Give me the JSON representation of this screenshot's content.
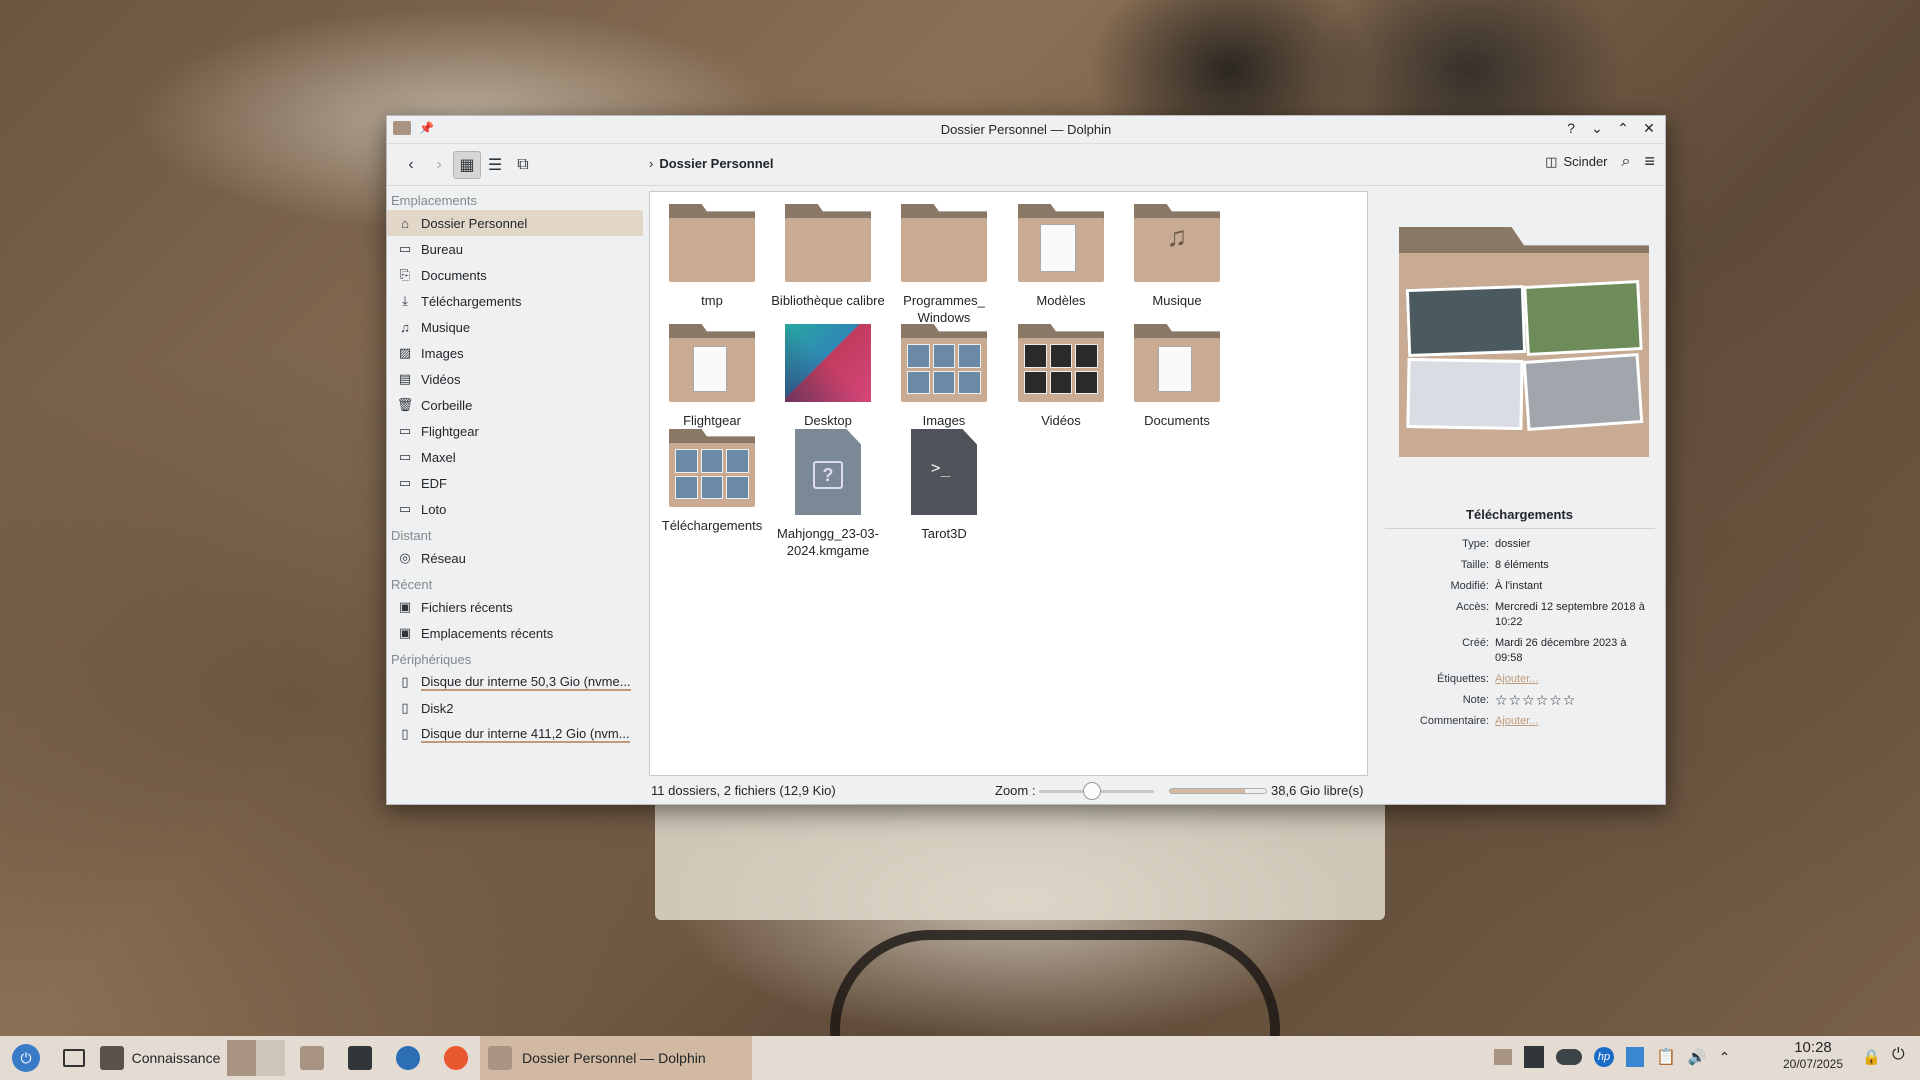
{
  "window": {
    "title": "Dossier Personnel — Dolphin",
    "breadcrumb": "Dossier Personnel",
    "split_label": "Scinder"
  },
  "sidebar": {
    "sections": [
      {
        "title": "Emplacements",
        "items": [
          {
            "label": "Dossier Personnel",
            "icon": "home-icon",
            "glyph": "⌂",
            "selected": true
          },
          {
            "label": "Bureau",
            "icon": "desktop-icon",
            "glyph": "▭"
          },
          {
            "label": "Documents",
            "icon": "documents-icon",
            "glyph": "⎘"
          },
          {
            "label": "Téléchargements",
            "icon": "download-icon",
            "glyph": "⤓"
          },
          {
            "label": "Musique",
            "icon": "music-icon",
            "glyph": "♫"
          },
          {
            "label": "Images",
            "icon": "images-icon",
            "glyph": "▨"
          },
          {
            "label": "Vidéos",
            "icon": "video-icon",
            "glyph": "▤"
          },
          {
            "label": "Corbeille",
            "icon": "trash-icon",
            "glyph": "🗑"
          },
          {
            "label": "Flightgear",
            "icon": "folder-icon",
            "glyph": "▭"
          },
          {
            "label": "Maxel",
            "icon": "folder-icon",
            "glyph": "▭"
          },
          {
            "label": "EDF",
            "icon": "folder-icon",
            "glyph": "▭"
          },
          {
            "label": "Loto",
            "icon": "folder-icon",
            "glyph": "▭"
          }
        ]
      },
      {
        "title": "Distant",
        "items": [
          {
            "label": "Réseau",
            "icon": "network-icon",
            "glyph": "◎"
          }
        ]
      },
      {
        "title": "Récent",
        "items": [
          {
            "label": "Fichiers récents",
            "icon": "recent-files-icon",
            "glyph": "▣"
          },
          {
            "label": "Emplacements récents",
            "icon": "recent-locations-icon",
            "glyph": "▣"
          }
        ]
      },
      {
        "title": "Périphériques",
        "items": [
          {
            "label": "Disque dur interne 50,3 Gio (nvme...",
            "icon": "drive-icon",
            "glyph": "▯",
            "disk": true
          },
          {
            "label": "Disk2",
            "icon": "drive-icon",
            "glyph": "▯"
          },
          {
            "label": "Disque dur interne 411,2 Gio (nvm...",
            "icon": "drive-icon",
            "glyph": "▯",
            "disk": true
          }
        ]
      }
    ]
  },
  "files": [
    {
      "name": "tmp",
      "kind": "folder"
    },
    {
      "name": "Bibliothèque calibre",
      "kind": "folder"
    },
    {
      "name": "Programmes_\nWindows",
      "kind": "folder"
    },
    {
      "name": "Modèles",
      "kind": "folder-templates"
    },
    {
      "name": "Musique",
      "kind": "folder-music"
    },
    {
      "name": "Flightgear",
      "kind": "folder-doc"
    },
    {
      "name": "Desktop",
      "kind": "image"
    },
    {
      "name": "Images",
      "kind": "folder-thumbs"
    },
    {
      "name": "Vidéos",
      "kind": "folder-thumbs-dark"
    },
    {
      "name": "Documents",
      "kind": "folder-doc"
    },
    {
      "name": "Téléchargements",
      "kind": "folder-thumbs"
    },
    {
      "name": "Mahjongg_23-03-\n2024.kmgame",
      "kind": "file-unknown"
    },
    {
      "name": "Tarot3D",
      "kind": "file-exec"
    }
  ],
  "info": {
    "title": "Téléchargements",
    "rows": [
      {
        "k": "Type:",
        "v": "dossier"
      },
      {
        "k": "Taille:",
        "v": "8 éléments"
      },
      {
        "k": "Modifié:",
        "v": "À l'instant"
      },
      {
        "k": "Accès:",
        "v": "Mercredi 12 septembre 2018 à 10:22"
      },
      {
        "k": "Créé:",
        "v": "Mardi 26 décembre 2023 à 09:58"
      },
      {
        "k": "Étiquettes:",
        "v": "Ajouter...",
        "link": true
      },
      {
        "k": "Note:",
        "v": "☆☆☆☆☆☆",
        "stars": true
      },
      {
        "k": "Commentaire:",
        "v": "Ajouter...",
        "link": true
      }
    ]
  },
  "status": {
    "summary": "11 dossiers, 2 fichiers (12,9 Kio)",
    "zoom_label": "Zoom :",
    "free_space": "38,6 Gio libre(s)"
  },
  "taskbar": {
    "pinned_label": "Connaissance",
    "active_window": "Dossier Personnel — Dolphin",
    "time": "10:28",
    "date": "20/07/2025"
  },
  "colors": {
    "accent": "#c09a79",
    "folder": "#c8ab92",
    "selection": "#e2d6c9"
  }
}
